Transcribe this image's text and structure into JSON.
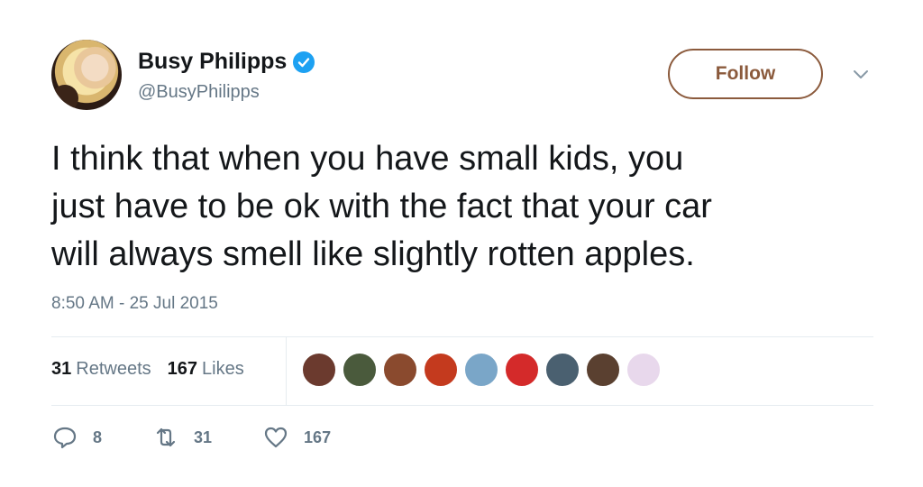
{
  "user": {
    "display_name": "Busy Philipps",
    "handle": "@BusyPhilipps",
    "verified_icon": "verified-badge-icon"
  },
  "follow_button": {
    "label": "Follow"
  },
  "tweet": {
    "lines": [
      "I think that when you have small kids, you",
      "just have to be ok with the fact that your car",
      "will always smell like slightly rotten apples."
    ],
    "timestamp": "8:50 AM - 25 Jul 2015"
  },
  "stats": {
    "retweets_count": "31",
    "retweets_label": "Retweets",
    "likes_count": "167",
    "likes_label": "Likes"
  },
  "likers": [
    {
      "color": "#6b3a2e"
    },
    {
      "color": "#4a5a3c"
    },
    {
      "color": "#8a4a2e"
    },
    {
      "color": "#c43a1e"
    },
    {
      "color": "#7aa6c8"
    },
    {
      "color": "#d42a2a"
    },
    {
      "color": "#4a6070"
    },
    {
      "color": "#5a4030"
    },
    {
      "color": "#e8d8ec"
    }
  ],
  "actions": {
    "reply_count": "8",
    "retweet_count": "31",
    "like_count": "167"
  },
  "colors": {
    "follow_accent": "#8b5a3c",
    "verified_blue": "#1da1f2",
    "muted_text": "#657786"
  }
}
